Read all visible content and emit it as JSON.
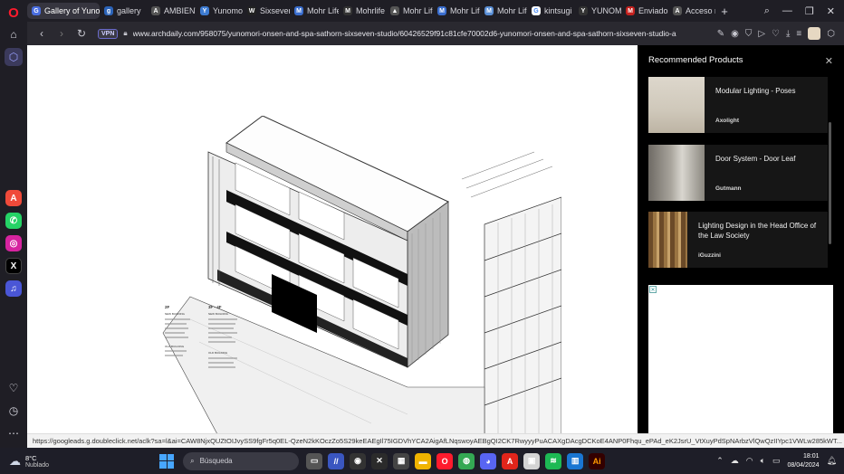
{
  "tabs": [
    {
      "label": "Gallery of Yunomo",
      "color": "#4a6ee0",
      "glyph": "G",
      "active": true
    },
    {
      "label": "gallery",
      "color": "#2b63b8",
      "glyph": "g"
    },
    {
      "label": "AMBIENTE",
      "color": "#555",
      "glyph": "A"
    },
    {
      "label": "Yunomor",
      "color": "#3d7bd1",
      "glyph": "Y"
    },
    {
      "label": "Sixseven S",
      "color": "#222",
      "glyph": "W"
    },
    {
      "label": "Mohr Life",
      "color": "#3a6ecf",
      "glyph": "M"
    },
    {
      "label": "Mohrlife",
      "color": "#333",
      "glyph": "M"
    },
    {
      "label": "Mohr Life",
      "color": "#555",
      "glyph": "▲"
    },
    {
      "label": "Mohr Life",
      "color": "#3a6ecf",
      "glyph": "M"
    },
    {
      "label": "Mohr Life",
      "color": "#5a8fd6",
      "glyph": "M"
    },
    {
      "label": "kintsugi d",
      "color": "#fff",
      "glyph": "G"
    },
    {
      "label": "YUNOMO",
      "color": "#333",
      "glyph": "Y"
    },
    {
      "label": "Enviados",
      "color": "#c5221f",
      "glyph": "M"
    },
    {
      "label": "Acceso rá",
      "color": "#555",
      "glyph": "A"
    }
  ],
  "addressbar": {
    "vpn_label": "VPN",
    "url": "www.archdaily.com/958075/yunomori-onsen-and-spa-sathorn-sixseven-studio/60426529f91c81cfe70002d6-yunomori-onsen-and-spa-sathorn-sixseven-studio-axo-section"
  },
  "recommended": {
    "title": "Recommended Products",
    "items": [
      {
        "name": "Modular Lighting - Poses",
        "brand": "Axolight",
        "img_color": "#d8d2c6"
      },
      {
        "name": "Door System - Door Leaf",
        "brand": "Gutmann",
        "img_color": "#8e8b85"
      },
      {
        "name": "Lighting Design in the Head Office of the Law Society",
        "brand": "iGuzzini",
        "img_color": "#7a5a34"
      }
    ]
  },
  "status_url": "https://googleads.g.doubleclick.net/aclk?sa=l&ai=CAW8NjxQUZtOIJvySS9fgFr5q0EL-QzeN2kKOczZo5S29keEAEgIl75IGDVhYCA2AigAfLNqswoyAEBgQI2CK7RwyyyPuACAXgDAcgDCKoE4ANP0Fhqu_ePAd_eK2JsrU_VtXuyPdSpNArbzVlQwQzIIYpc1VWLw285kWT...",
  "drawing": {
    "legend_2f_title": "2F",
    "legend_2f_sub": "NEW BUILDING",
    "legend_34f_title": "3F - 4F",
    "legend_34f_sub": "NEW BUILDING",
    "legend_old": "OLD BUILDING"
  },
  "taskbar": {
    "temp": "8°C",
    "condition": "Nublado",
    "search_placeholder": "Búsqueda",
    "time": "18:01",
    "date": "08/04/2024"
  }
}
